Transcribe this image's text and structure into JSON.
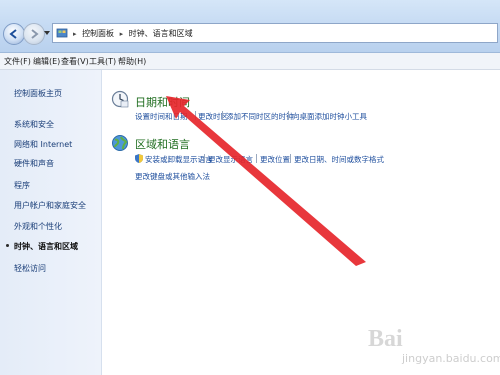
{
  "address_bar": {
    "crumbs": [
      "控制面板",
      "时钟、语言和区域"
    ]
  },
  "menu": [
    "文件(F)",
    "编辑(E)",
    "查看(V)",
    "工具(T)",
    "帮助(H)"
  ],
  "sidebar": {
    "items": [
      {
        "label": "控制面板主页"
      },
      {
        "label": "系统和安全"
      },
      {
        "label": "网络和 Internet"
      },
      {
        "label": "硬件和声音"
      },
      {
        "label": "程序"
      },
      {
        "label": "用户帐户和家庭安全"
      },
      {
        "label": "外观和个性化"
      },
      {
        "label": "时钟、语言和区域"
      },
      {
        "label": "轻松访问"
      }
    ]
  },
  "categories": [
    {
      "title": "日期和时间",
      "links": [
        "设置时间和日期",
        "更改时区",
        "添加不同时区的时钟",
        "向桌面添加时钟小工具"
      ]
    },
    {
      "title": "区域和语言",
      "links": [
        "安装或卸载显示语言",
        "更改显示语言",
        "更改位置",
        "更改日期、时间或数字格式",
        "更改键盘或其他输入法"
      ]
    }
  ],
  "watermark": {
    "brand": "Bai",
    "site": "jingyan.baidu.com"
  },
  "colors": {
    "annotation_arrow": "#e6262b",
    "category_title": "#1f6d1f",
    "task_link": "#1f4f9e"
  }
}
